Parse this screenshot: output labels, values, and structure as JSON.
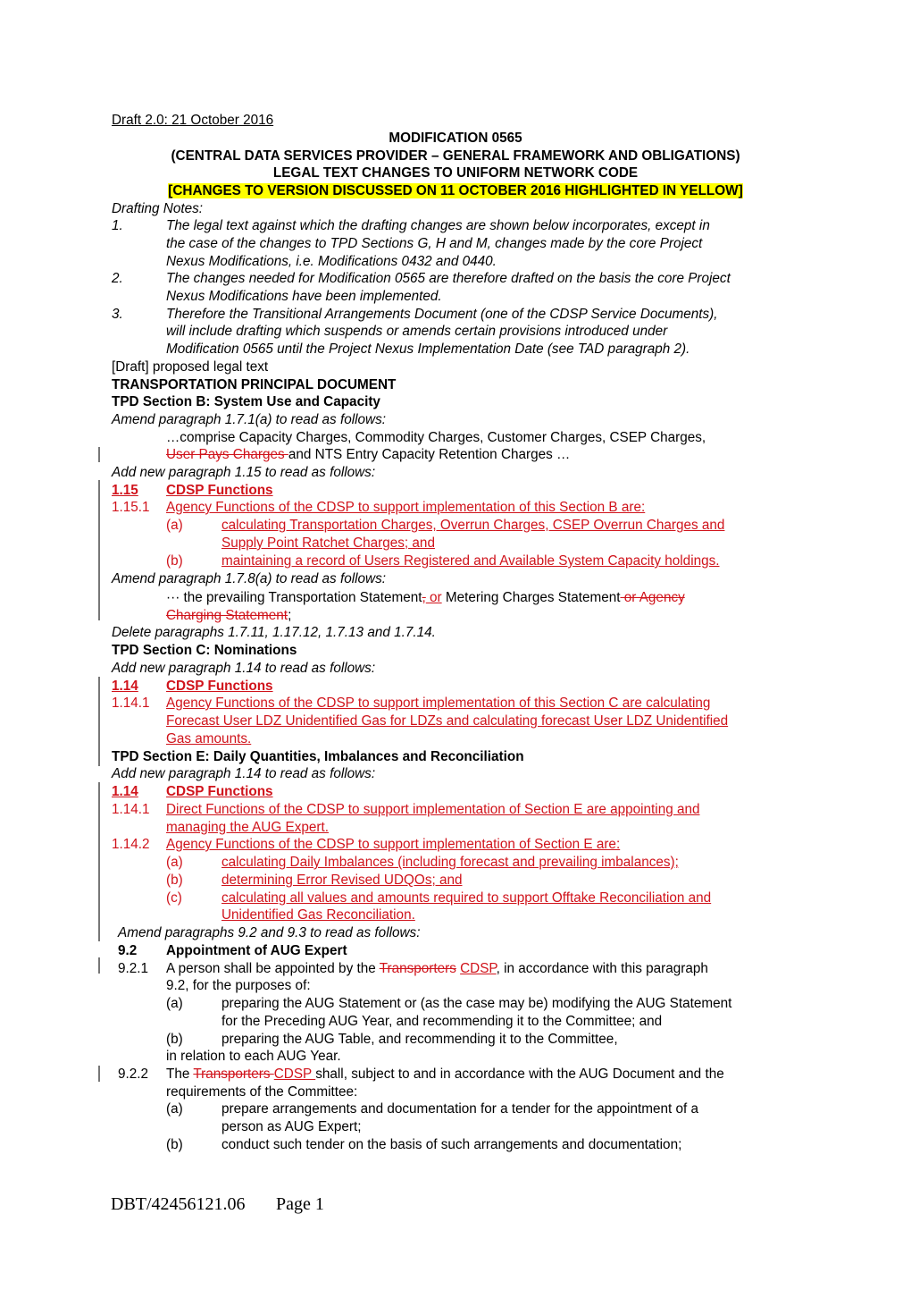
{
  "header": {
    "draft_label": "Draft 2.0: 21 October 2016",
    "modification": "MODIFICATION 0565",
    "subtitle": "(CENTRAL DATA SERVICES PROVIDER – GENERAL FRAMEWORK AND OBLIGATIONS)",
    "legal_title": "LEGAL TEXT CHANGES TO UNIFORM NETWORK CODE",
    "highlight_note": "[CHANGES TO VERSION DISCUSSED ON 11 OCTOBER 2016 HIGHLIGHTED IN YELLOW]",
    "highlight_color": "#ffff00"
  },
  "drafting_notes": {
    "heading": "Drafting Notes:",
    "items": [
      {
        "num": "1.",
        "lines": [
          "The legal text against which the drafting changes are shown below incorporates, except in",
          "the case of the changes to TPD Sections G, H and M,  changes made by the core Project",
          "Nexus Modifications, i.e. Modifications 0432 and 0440."
        ]
      },
      {
        "num": "2.",
        "lines": [
          "The changes needed for Modification 0565 are therefore drafted on the basis the core Project",
          "Nexus Modifications have been implemented."
        ]
      },
      {
        "num": "3.",
        "lines": [
          "Therefore the Transitional Arrangements Document (one of the CDSP Service Documents),",
          "will include drafting which suspends or amends certain provisions introduced under",
          "Modification 0565 until the Project Nexus Implementation Date (see TAD paragraph 2)."
        ]
      }
    ]
  },
  "body": {
    "proposed": "[Draft] proposed legal text",
    "tpd_title": "TRANSPORTATION PRINCIPAL DOCUMENT",
    "section_b": {
      "heading": "TPD Section B: System Use and Capacity",
      "instr1": "Amend paragraph 1.7.1(a) to read as follows:",
      "p171_line1": "…comprise Capacity Charges, Commodity Charges, Customer Charges, CSEP Charges,",
      "p171_del": "User Pays Charges ",
      "p171_rest": "and NTS Entry Capacity Retention Charges …",
      "instr2": "Add new paragraph 1.15 to read as follows:",
      "h115_num": "1.15",
      "h115_title": "CDSP Functions",
      "p1151_num": "1.15.1",
      "p1151_text": "Agency Functions of the CDSP to support implementation of this Section B are:",
      "a_label": "(a)",
      "a_line1": "calculating Transportation Charges, Overrun Charges, CSEP Overrun Charges and ",
      "a_line2": "Supply Point Ratchet Charges; and",
      "b_label": "(b)",
      "b_line1": "maintaining a record of Users Registered and Available System Capacity holdings.",
      "instr3": "Amend paragraph 1.7.8(a) to read as follows:",
      "p178_prefix": "··· the prevailing Transportation Statement",
      "p178_del1": ",",
      "p178_ins1": " or",
      "p178_mid": " Metering Charges Statement",
      "p178_del2": " or Agency ",
      "p178_del3": "Charging Statement",
      "p178_end": ";",
      "instr4": "Delete paragraphs 1.7.11, 1.17.12, 1.7.13 and 1.7.14."
    },
    "section_c": {
      "heading": "TPD Section C: Nominations",
      "instr": "Add new paragraph 1.14 to read as follows:",
      "h114_num": "1.14",
      "h114_title": "CDSP Functions",
      "p1141_num": "1.14.1",
      "p1141_line1": "Agency Functions of the CDSP to support implementation of this Section C are calculating ",
      "p1141_line2": "Forecast User LDZ Unidentified Gas for LDZs and calculating forecast User LDZ Unidentified ",
      "p1141_line3": "Gas amounts. "
    },
    "section_e": {
      "heading": "TPD Section E: Daily Quantities, Imbalances and Reconciliation",
      "instr": "Add new paragraph 1.14 to read as follows:",
      "h114_num": "1.14",
      "h114_title": "CDSP Functions",
      "p1141_num": "1.14.1",
      "p1141_line1": "Direct Functions of the CDSP to support implementation of Section E are appointing and ",
      "p1141_line2": "managing the AUG Expert.",
      "p1142_num": "1.14.2",
      "p1142_line1": "Agency Functions of the CDSP to support implementation of Section E  are:",
      "a_label": "(a)",
      "a_text": "calculating Daily Imbalances (including forecast and prevailing imbalances);",
      "b_label": "(b)",
      "b_text": "determining Error Revised UDQOs; and",
      "c_label": "(c)",
      "c_line1": "calculating all values and amounts required to support Offtake Reconciliation and ",
      "c_line2": "Unidentified Gas Reconciliation.",
      "instr2": "Amend paragraphs 9.2 and 9.3 to read as follows:",
      "h92_num": "9.2",
      "h92_title": "Appointment of AUG Expert",
      "p921_num": "9.2.1",
      "p921_pre": "A person shall be appointed by the ",
      "p921_del": "Transporters",
      "p921_ins": "CDSP",
      "p921_post": ", in accordance with this paragraph",
      "p921_line2": "9.2, for  the purposes of:",
      "p921_a_label": "(a)",
      "p921_a_line1": "preparing the AUG Statement or (as the case may be) modifying the AUG Statement",
      "p921_a_line2": "for the Preceding AUG Year, and recommending it to the Committee; and",
      "p921_b_label": "(b)",
      "p921_b_line1": "preparing the AUG Table, and recommending it to the Committee,",
      "p921_tail": "in relation to each AUG Year.",
      "p922_num": "9.2.2",
      "p922_pre": "The ",
      "p922_del": "Transporters ",
      "p922_ins": "CDSP ",
      "p922_post": "shall, subject to and in accordance with the AUG Document and the",
      "p922_line2": "requirements of the Committee:",
      "p922_a_label": "(a)",
      "p922_a_line1": "prepare arrangements and documentation for a tender for the appointment of a",
      "p922_a_line2": "person as AUG Expert;",
      "p922_b_label": "(b)",
      "p922_b_line1": "conduct such tender on the basis of such arrangements and documentation;"
    }
  },
  "footer": {
    "doc_ref": "DBT/42456121.06",
    "page_label": "Page 1"
  },
  "colors": {
    "insertion": "#d0131b",
    "deletion": "#d0131b",
    "change_bar": "#777777"
  }
}
